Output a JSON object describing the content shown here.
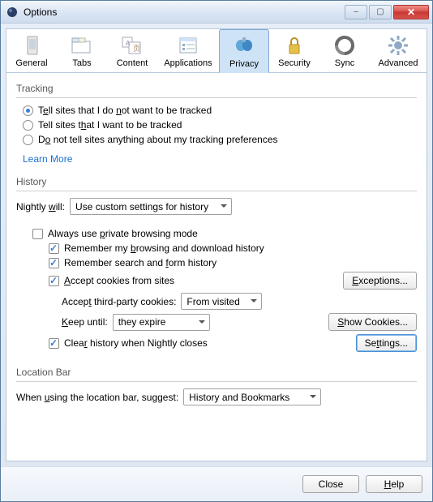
{
  "window": {
    "title": "Options"
  },
  "tabs": {
    "general": "General",
    "tabs": "Tabs",
    "content": "Content",
    "applications": "Applications",
    "privacy": "Privacy",
    "security": "Security",
    "sync": "Sync",
    "advanced": "Advanced",
    "selected": "privacy"
  },
  "tracking": {
    "heading": "Tracking",
    "opt_do_not_track": "Tell sites that I do not want to be tracked",
    "opt_do_track": "Tell sites that I want to be tracked",
    "opt_no_pref": "Do not tell sites anything about my tracking preferences",
    "selected": "opt_do_not_track",
    "learn_more": "Learn More"
  },
  "history": {
    "heading": "History",
    "will_label": "Nightly will:",
    "will_value": "Use custom settings for history",
    "always_private": "Always use private browsing mode",
    "always_private_checked": false,
    "remember_browsing": "Remember my browsing and download history",
    "remember_browsing_checked": true,
    "remember_search": "Remember search and form history",
    "remember_search_checked": true,
    "accept_cookies": "Accept cookies from sites",
    "accept_cookies_checked": true,
    "exceptions_btn": "Exceptions...",
    "accept_third_label": "Accept third-party cookies:",
    "accept_third_value": "From visited",
    "keep_until_label": "Keep until:",
    "keep_until_value": "they expire",
    "show_cookies_btn": "Show Cookies...",
    "clear_on_close": "Clear history when Nightly closes",
    "clear_on_close_checked": true,
    "settings_btn": "Settings..."
  },
  "locationbar": {
    "heading": "Location Bar",
    "suggest_label": "When using the location bar, suggest:",
    "suggest_value": "History and Bookmarks"
  },
  "footer": {
    "close": "Close",
    "help": "Help"
  }
}
